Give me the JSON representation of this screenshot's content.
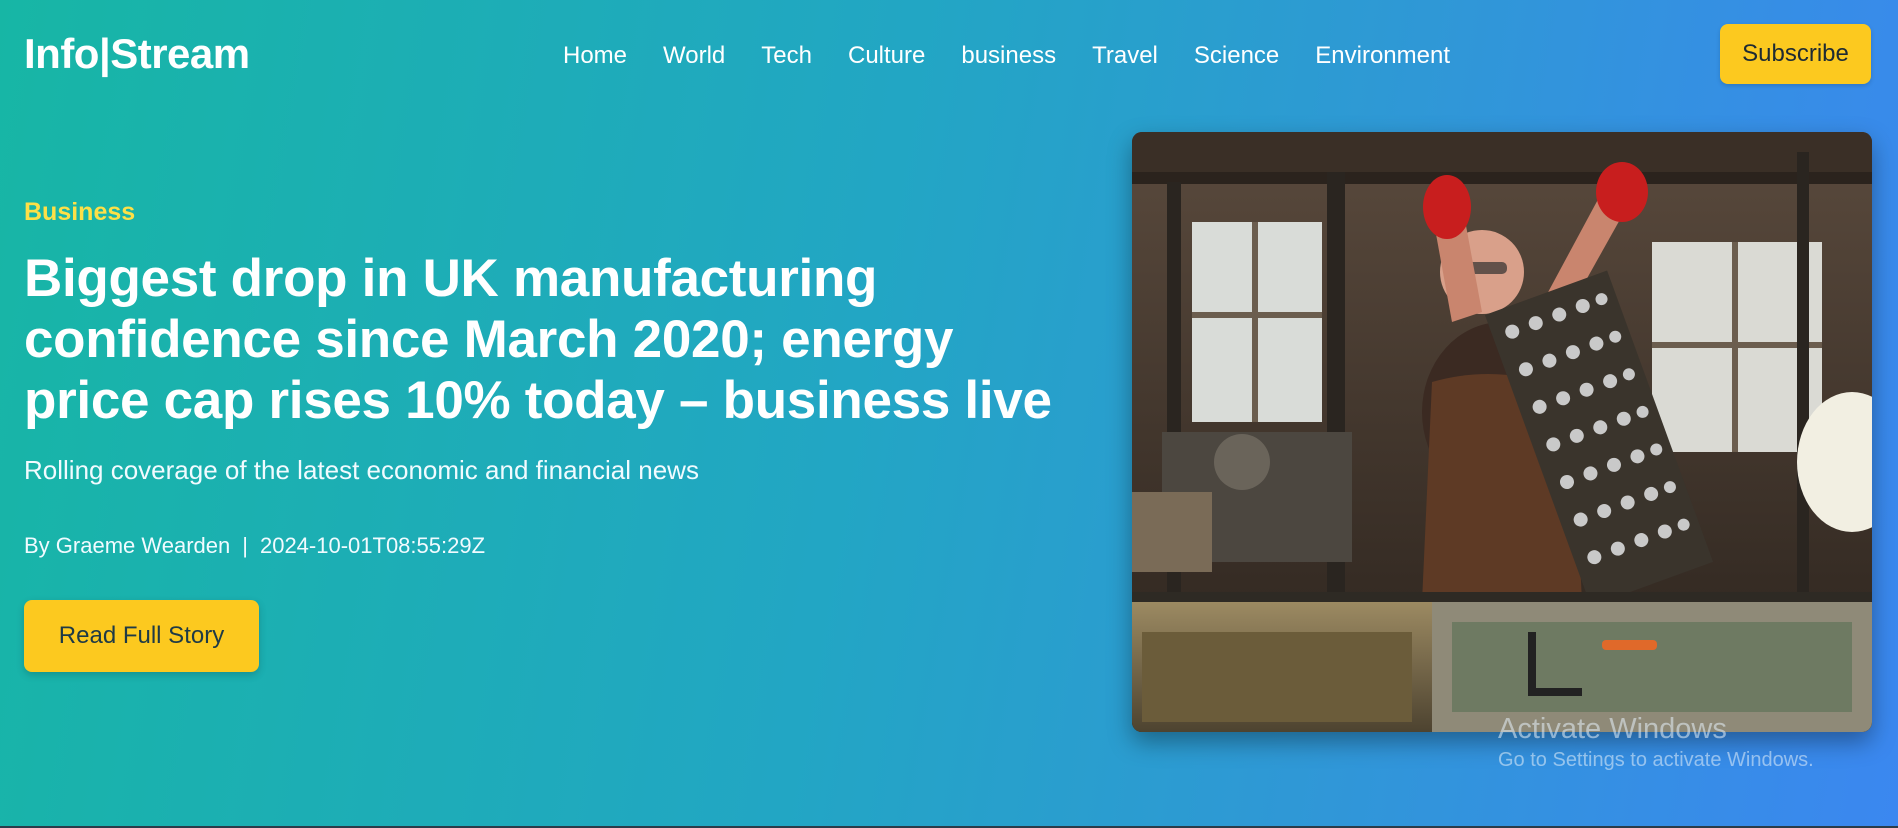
{
  "header": {
    "logo": "Info|Stream",
    "nav": [
      "Home",
      "World",
      "Tech",
      "Culture",
      "business",
      "Travel",
      "Science",
      "Environment"
    ],
    "subscribe_label": "Subscribe"
  },
  "hero": {
    "category": "Business",
    "headline": "Biggest drop in UK manufacturing confidence since March 2020; energy price cap rises 10% today – business live",
    "subtitle": "Rolling coverage of the latest economic and financial news",
    "author": "By Graeme Wearden",
    "separator": "|",
    "timestamp": "2024-10-01T08:55:29Z",
    "cta_label": "Read Full Story",
    "image_description_icon": "factory-worker-photo"
  },
  "watermark": {
    "title": "Activate Windows",
    "subtitle": "Go to Settings to activate Windows."
  },
  "colors": {
    "accent_yellow": "#fcc91f",
    "category_yellow": "#fde047",
    "gradient_start": "#17b6a5",
    "gradient_end": "#3b87f0"
  }
}
